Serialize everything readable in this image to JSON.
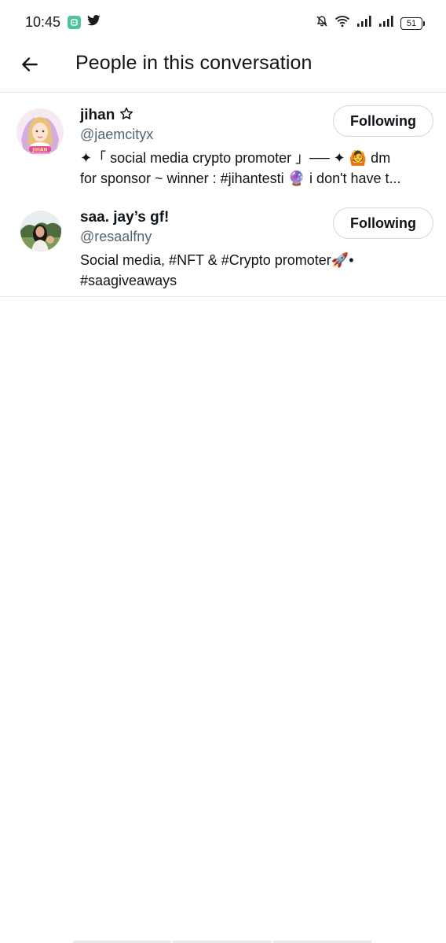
{
  "status_bar": {
    "time": "10:45",
    "battery": "51",
    "icons": [
      "app-notification-icon",
      "twitter-bird-icon",
      "bell-muted-icon",
      "wifi-icon",
      "signal-icon",
      "signal-icon",
      "battery-icon"
    ]
  },
  "header": {
    "back_icon": "arrow-left-icon",
    "title": "People in this conversation"
  },
  "people": [
    {
      "display_name": "jihan",
      "name_badge": "star-outline-icon",
      "handle": "@jaemcityx",
      "bio_line_1": "✦「 social media crypto promoter 」── ✦ 🙆 dm",
      "bio_line_2": "for sponsor ~ winner : #jihantesti 🔮 i don't have t...",
      "follow_label": "Following"
    },
    {
      "display_name": "saa. jay’s gf!",
      "handle": "@resaalfny",
      "bio_line_1": "Social media, #NFT & #Crypto promoter🚀•",
      "bio_line_2": "#saagiveaways",
      "follow_label": "Following"
    }
  ],
  "colors": {
    "text_primary": "#0f1419",
    "text_secondary": "#536471",
    "divider": "#e3e8eb",
    "button_border": "#cfd9de"
  }
}
